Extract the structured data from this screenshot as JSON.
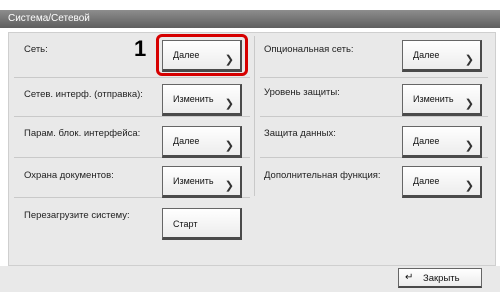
{
  "window": {
    "title": "Система/Сетевой"
  },
  "callout": {
    "number": "1"
  },
  "left": [
    {
      "label": "Сеть:",
      "button": "Далее"
    },
    {
      "label": "Сетев. интерф. (отправка):",
      "button": "Изменить"
    },
    {
      "label": "Парам. блок. интерфейса:",
      "button": "Далее"
    },
    {
      "label": "Охрана документов:",
      "button": "Изменить"
    },
    {
      "label": "Перезагрузите систему:",
      "button": "Старт"
    }
  ],
  "right": [
    {
      "label": "Опциональная сеть:",
      "button": "Далее"
    },
    {
      "label": "Уровень защиты:",
      "button": "Изменить"
    },
    {
      "label": "Защита данных:",
      "button": "Далее"
    },
    {
      "label": "Дополнительная функция:",
      "button": "Далее"
    }
  ],
  "footer": {
    "close_label": "Закрыть",
    "close_icon": "enter-return-icon"
  },
  "icons": {
    "chevron": "chevron-right-icon"
  },
  "colors": {
    "highlight": "#d60000",
    "titlebar": "#6f6f6f"
  }
}
